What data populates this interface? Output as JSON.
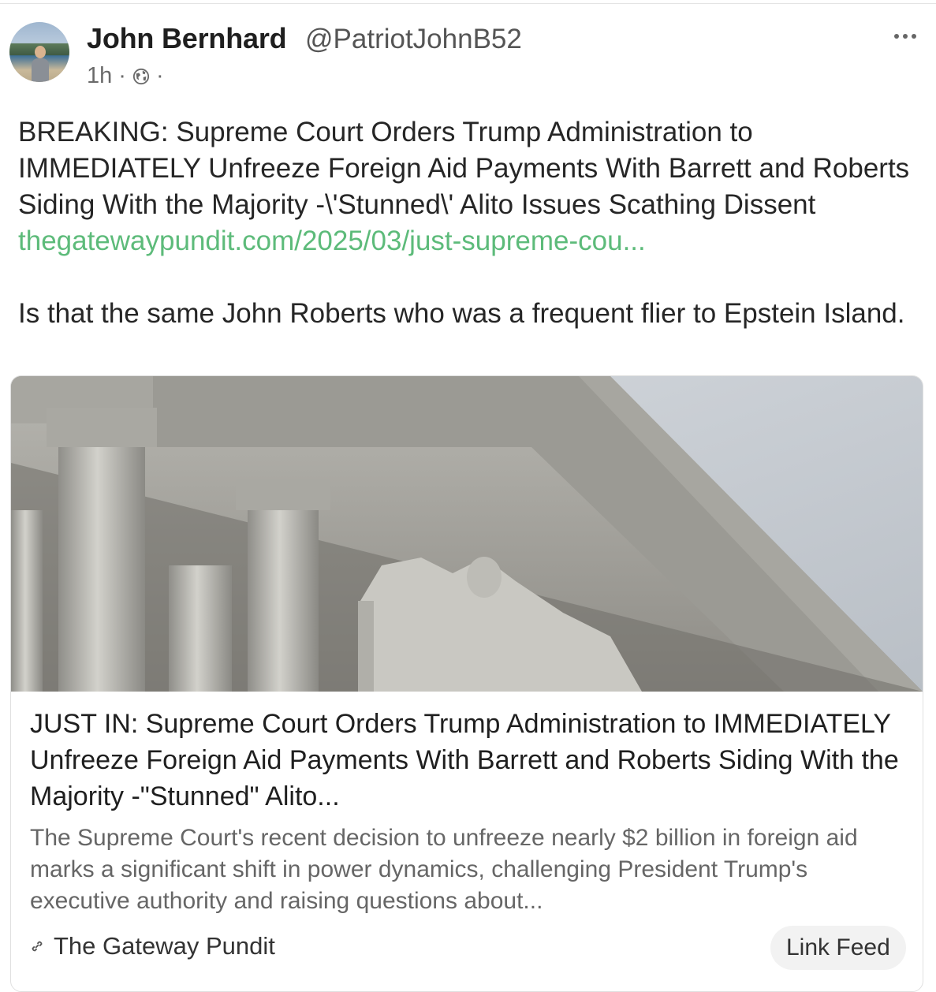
{
  "post": {
    "author_name": "John Bernhard",
    "author_handle": "@PatriotJohnB52",
    "time": "1h",
    "separator": "·",
    "text_line1": "BREAKING: Supreme Court Orders Trump Administration to IMMEDIATELY Unfreeze Foreign Aid Payments With Barrett and Roberts Siding With the Majority -\\'Stunned\\' Alito Issues Scathing Dissent ",
    "link_text": "thegatewaypundit.com/2025/03/just-supreme-cou...",
    "text_line2": "Is that the same John Roberts who was a frequent flier to Epstein Island."
  },
  "card": {
    "title": "JUST IN: Supreme Court Orders Trump Administration to IMMEDIATELY Unfreeze Foreign Aid Payments With Barrett and Roberts Siding With the Majority -\"Stunned\" Alito...",
    "description": "The Supreme Court's recent decision to unfreeze nearly $2 billion in foreign aid marks a significant shift in power dynamics, challenging President Trump's executive authority and raising questions about...",
    "source": "The Gateway Pundit",
    "feed_button": "Link Feed"
  },
  "colors": {
    "link": "#5dbb7a",
    "text": "#262626",
    "muted": "#666666"
  },
  "icons": [
    "globe-icon",
    "more-icon",
    "link-icon"
  ]
}
